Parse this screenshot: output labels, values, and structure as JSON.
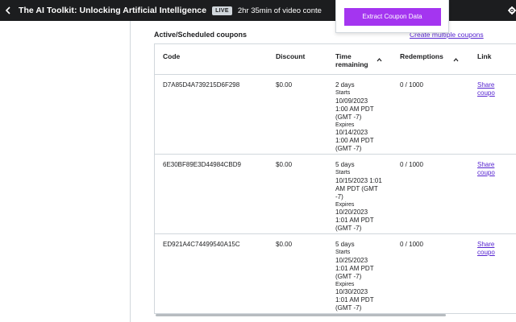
{
  "header": {
    "course_title": "The AI Toolkit: Unlocking Artificial Intelligence",
    "live_badge": "LIVE",
    "video_length": "2hr 35min of video conte"
  },
  "popup": {
    "extract_button": "Extract Coupon Data"
  },
  "section": {
    "title": "Active/Scheduled coupons",
    "create_link": "Create multiple coupons"
  },
  "table": {
    "headers": {
      "code": "Code",
      "discount": "Discount",
      "time_remaining_1": "Time",
      "time_remaining_2": "remaining",
      "redemptions": "Redemptions",
      "link": "Link"
    },
    "rows": [
      {
        "code": "D7A85D4A739215D6F298",
        "discount": "$0.00",
        "days": "2 days",
        "starts_label": "Starts",
        "starts": [
          "10/09/2023",
          "1:00 AM PDT",
          "(GMT -7)"
        ],
        "expires_label": "Expires",
        "expires": [
          "10/14/2023",
          "1:00 AM PDT",
          "(GMT -7)"
        ],
        "redemptions": "0 / 1000",
        "link_1": "Share",
        "link_2": "coupo"
      },
      {
        "code": "6E30BF89E3D44984CBD9",
        "discount": "$0.00",
        "days": "5 days",
        "starts_label": "Starts",
        "starts": [
          "10/15/2023 1:01",
          "AM PDT (GMT",
          "-7)"
        ],
        "expires_label": "Expires",
        "expires": [
          "10/20/2023",
          "1:01 AM PDT",
          "(GMT -7)"
        ],
        "redemptions": "0 / 1000",
        "link_1": "Share",
        "link_2": "coupo"
      },
      {
        "code": "ED921A4C74499540A15C",
        "discount": "$0.00",
        "days": "5 days",
        "starts_label": "Starts",
        "starts": [
          "10/25/2023",
          "1:01 AM PDT",
          "(GMT -7)"
        ],
        "expires_label": "Expires",
        "expires": [
          "10/30/2023",
          "1:01 AM PDT",
          "(GMT -7)"
        ],
        "redemptions": "0 / 1000",
        "link_1": "Share",
        "link_2": "coupo"
      }
    ]
  },
  "colors": {
    "topbar": "#1c1d1f",
    "accent": "#a435f0",
    "link": "#5624d0",
    "border": "#d1d7dc"
  },
  "icons": {
    "back": "chevron-left-icon",
    "settings": "gear-icon",
    "sort": "chevron-up-icon"
  }
}
